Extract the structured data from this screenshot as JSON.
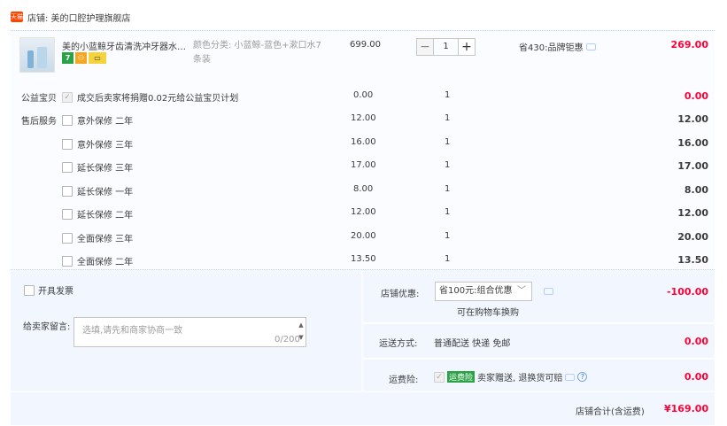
{
  "shop": {
    "badge": "天猫",
    "label": "店铺: 美的口腔护理旗舰店"
  },
  "item": {
    "title": "美的小蓝鲸牙齿清洗冲牙器水牙...",
    "service_icons": [
      "7",
      "⚇",
      "▭"
    ],
    "sku": "颜色分类: 小蓝鲸-蓝色+漱口水7条装",
    "unit_price": "699.00",
    "qty_minus": "−",
    "qty_value": "1",
    "qty_plus": "+",
    "promo": "省430:品牌钜惠",
    "subtotal": "269.00"
  },
  "charity": {
    "label": "公益宝贝",
    "text": "成交后卖家将捐赠0.02元给公益宝贝计划",
    "price": "0.00",
    "qty": "1",
    "subtotal": "0.00"
  },
  "after_sales": {
    "label": "售后服务",
    "options": [
      {
        "name": "意外保修 二年",
        "price": "12.00",
        "qty": "1",
        "subtotal": "12.00"
      },
      {
        "name": "意外保修 三年",
        "price": "16.00",
        "qty": "1",
        "subtotal": "16.00"
      },
      {
        "name": "延长保修 三年",
        "price": "17.00",
        "qty": "1",
        "subtotal": "17.00"
      },
      {
        "name": "延长保修 一年",
        "price": "8.00",
        "qty": "1",
        "subtotal": "8.00"
      },
      {
        "name": "延长保修 二年",
        "price": "12.00",
        "qty": "1",
        "subtotal": "12.00"
      },
      {
        "name": "全面保修 三年",
        "price": "20.00",
        "qty": "1",
        "subtotal": "20.00"
      },
      {
        "name": "全面保修 二年",
        "price": "13.50",
        "qty": "1",
        "subtotal": "13.50"
      }
    ]
  },
  "invoice": {
    "label": "开具发票"
  },
  "message": {
    "label": "给卖家留言:",
    "placeholder": "选填,请先和商家协商一致",
    "count": "0/200"
  },
  "discount": {
    "label": "店铺优惠:",
    "selected": "省100元:组合优惠",
    "note": "可在购物车换购",
    "value": "-100.00"
  },
  "shipping": {
    "label": "运送方式:",
    "text": "普通配送 快递 免邮",
    "value": "0.00"
  },
  "insurance": {
    "label": "运费险:",
    "tag": "运费险",
    "text": "卖家赠送, 退换货可赔",
    "value": "0.00"
  },
  "total": {
    "label": "店铺合计(含运费)",
    "value": "¥169.00"
  },
  "colors": {
    "accent_red": "#ff0036",
    "panel_blue": "#f2f7ff",
    "tmall_red": "#ff4400",
    "green": "#2ba245"
  }
}
